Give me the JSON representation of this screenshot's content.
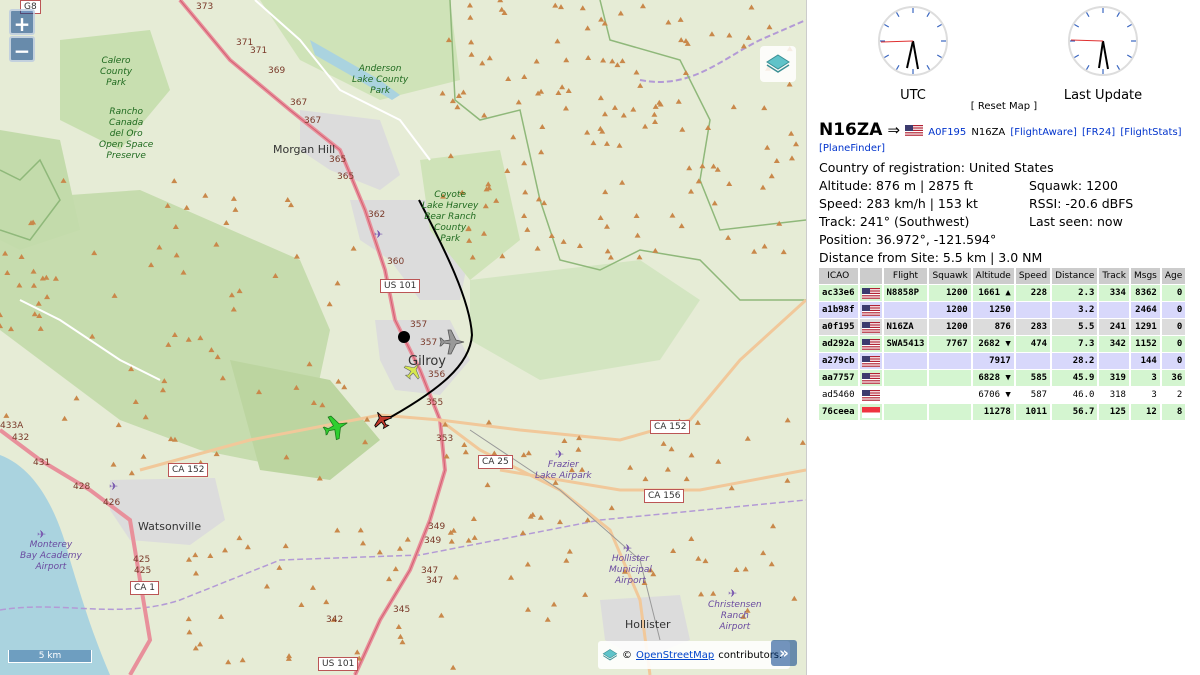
{
  "map": {
    "zoom_in": "+",
    "zoom_out": "−",
    "attr_toggle": "»",
    "scale": "5 km",
    "attribution": {
      "prefix": "©",
      "link": "OpenStreetMap",
      "suffix": "contributors."
    },
    "labels": {
      "morgan_hill": "Morgan Hill",
      "gilroy": "Gilroy",
      "watsonville": "Watsonville",
      "hollister": "Hollister",
      "calero": "Calero\nCounty\nPark",
      "anderson": "Anderson\nLake County\nPark",
      "rancho": "Rancho\nCanada\ndel Oro\nOpen Space\nPreserve",
      "coyote": "Coyote\nLake Harvey\nBear Ranch\nCounty\nPark",
      "frazier": "Frazier\nLake Airpark",
      "hollister_ap": "Hollister\nMunicipal\nAirport",
      "christensen": "Christensen\nRanch\nAirport",
      "monterey": "Monterey\nBay Academy\nAirport"
    },
    "shields": {
      "us101": "US 101",
      "us101b": "US 101",
      "ca152": "CA 152",
      "ca152w": "CA 152",
      "ca25": "CA 25",
      "ca156": "CA 156",
      "ca1": "CA 1",
      "g8": "G8"
    },
    "hwy_markers": [
      "373",
      "371",
      "371",
      "369",
      "367",
      "367",
      "365",
      "365",
      "362",
      "360",
      "357",
      "357",
      "356",
      "355",
      "353",
      "349",
      "349",
      "347",
      "347",
      "345",
      "342",
      "432",
      "431",
      "428",
      "426",
      "425",
      "425",
      "433A"
    ]
  },
  "panel": {
    "clocks": [
      {
        "label": "UTC"
      },
      {
        "label": "Last Update"
      }
    ],
    "reset_map": "[ Reset Map ]",
    "selected": {
      "registration": "N16ZA",
      "arrow": "⇒",
      "icao_link": "A0F195",
      "callsign": "N16ZA",
      "links": [
        "[FlightAware]",
        "[FR24]",
        "[FlightStats]",
        "[PlaneFinder]"
      ],
      "country": "Country of registration: United States",
      "altitude": "Altitude: 876 m | 2875 ft",
      "squawk": "Squawk: 1200",
      "speed": "Speed: 283 km/h | 153 kt",
      "rssi": "RSSI: -20.6 dBFS",
      "track": "Track: 241° (Southwest)",
      "last_seen": "Last seen: now",
      "position": "Position: 36.972°, -121.594°",
      "distance": "Distance from Site: 5.5 km | 3.0 NM"
    },
    "table": {
      "headers": [
        "ICAO",
        "",
        "Flight",
        "Squawk",
        "Altitude",
        "Speed",
        "Distance",
        "Track",
        "Msgs",
        "Age"
      ],
      "rows": [
        {
          "style": "green",
          "flag": "us",
          "cells": [
            "ac33e6",
            "N8858P",
            "1200",
            "1661 ▲",
            "228",
            "2.3",
            "334",
            "8362",
            "0"
          ]
        },
        {
          "style": "purple",
          "flag": "us",
          "cells": [
            "a1b98f",
            "",
            "1200",
            "1250",
            "",
            "3.2",
            "",
            "2464",
            "0"
          ]
        },
        {
          "style": "sel",
          "flag": "us",
          "cells": [
            "a0f195",
            "N16ZA",
            "1200",
            "876",
            "283",
            "5.5",
            "241",
            "1291",
            "0"
          ]
        },
        {
          "style": "green",
          "flag": "us",
          "cells": [
            "ad292a",
            "SWA5413",
            "7767",
            "2682 ▼",
            "474",
            "7.3",
            "342",
            "1152",
            "0"
          ]
        },
        {
          "style": "purple",
          "flag": "us",
          "cells": [
            "a279cb",
            "",
            "",
            "7917",
            "",
            "28.2",
            "",
            "144",
            "0"
          ]
        },
        {
          "style": "green",
          "flag": "us",
          "cells": [
            "aa7757",
            "",
            "",
            "6828 ▼",
            "585",
            "45.9",
            "319",
            "3",
            "36"
          ]
        },
        {
          "style": "white",
          "flag": "us",
          "cells": [
            "ad5460",
            "",
            "",
            "6706 ▼",
            "587",
            "46.0",
            "318",
            "3",
            "2"
          ]
        },
        {
          "style": "green",
          "flag": "sg",
          "cells": [
            "76ceea",
            "",
            "",
            "11278",
            "1011",
            "56.7",
            "125",
            "12",
            "8"
          ]
        }
      ]
    }
  }
}
